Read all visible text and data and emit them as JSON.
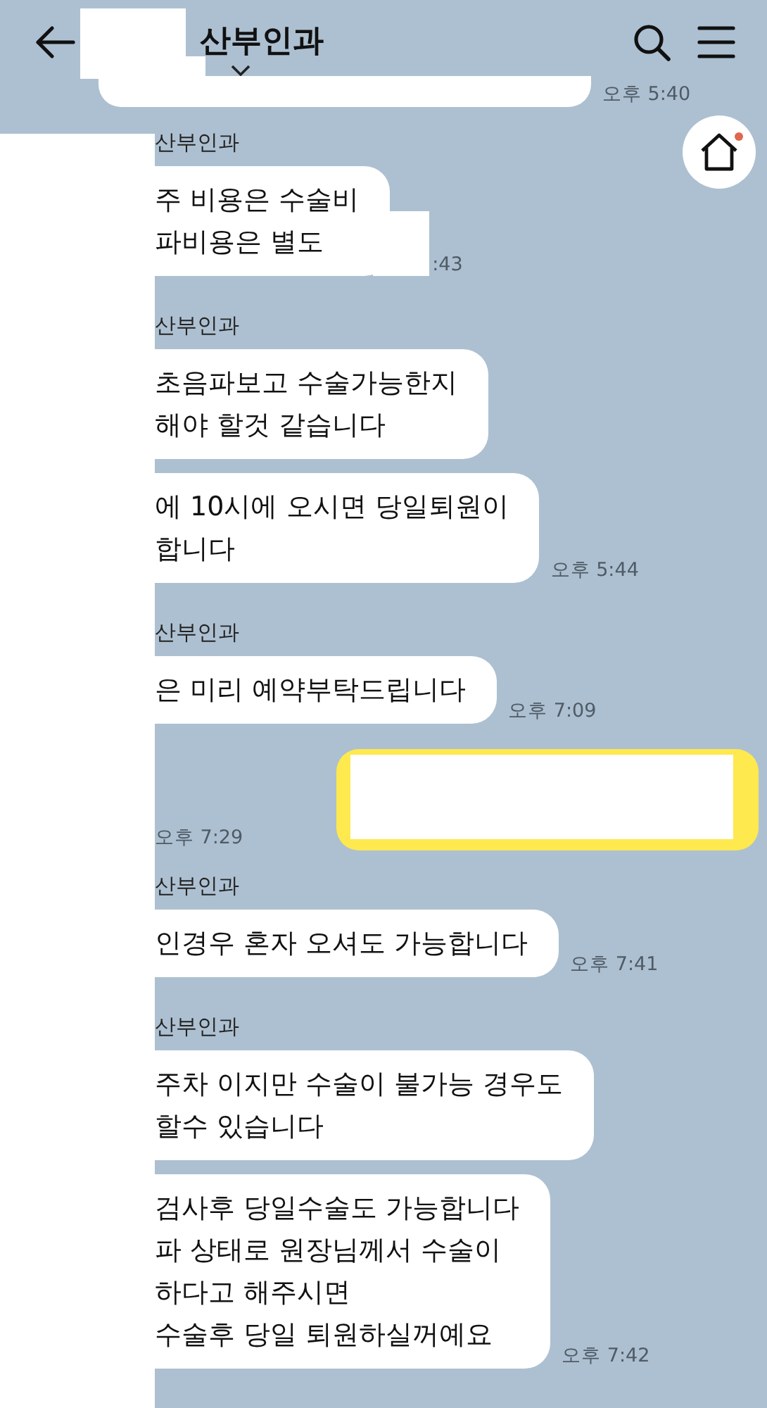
{
  "header": {
    "title": "산부인과"
  },
  "messages": [
    {
      "kind": "partial",
      "time": "오후 5:40"
    },
    {
      "kind": "sender",
      "name": "산부인과"
    },
    {
      "kind": "incoming",
      "lines": [
        "주 비용은 수술비",
        "파비용은 별도"
      ],
      "time": ":43",
      "redacted": true
    },
    {
      "kind": "sender",
      "name": "산부인과"
    },
    {
      "kind": "incoming",
      "lines": [
        "초음파보고 수술가능한지",
        "해야 할것 같습니다"
      ]
    },
    {
      "kind": "incoming",
      "lines": [
        "에 10시에 오시면 당일퇴원이",
        "합니다"
      ],
      "time": "오후 5:44"
    },
    {
      "kind": "sender",
      "name": "산부인과"
    },
    {
      "kind": "incoming",
      "lines": [
        "은 미리 예약부탁드립니다"
      ],
      "time": "오후 7:09"
    },
    {
      "kind": "outgoing",
      "time": "오후 7:29",
      "redacted": true
    },
    {
      "kind": "sender",
      "name": "산부인과"
    },
    {
      "kind": "incoming",
      "lines": [
        "인경우 혼자 오셔도 가능합니다"
      ],
      "time": "오후 7:41"
    },
    {
      "kind": "sender",
      "name": "산부인과"
    },
    {
      "kind": "incoming",
      "lines": [
        "주차 이지만 수술이 불가능 경우도",
        "할수 있습니다"
      ]
    },
    {
      "kind": "incoming",
      "lines": [
        "검사후 당일수술도 가능합니다",
        "파 상태로 원장님께서 수술이",
        "하다고 해주시면",
        "수술후 당일 퇴원하실꺼예요"
      ],
      "time": "오후 7:42"
    }
  ]
}
